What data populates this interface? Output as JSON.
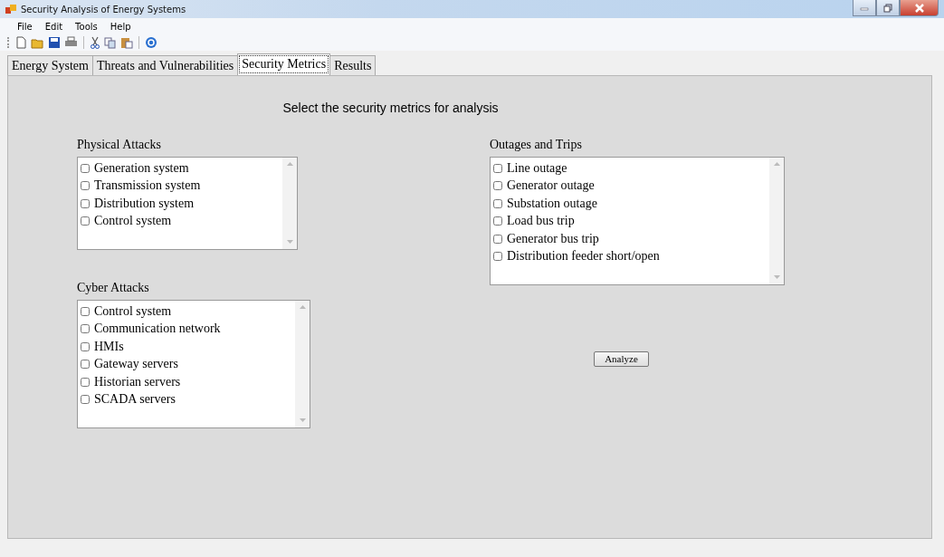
{
  "window": {
    "title": "Security Analysis of Energy Systems"
  },
  "menu": [
    {
      "label": "File"
    },
    {
      "label": "Edit"
    },
    {
      "label": "Tools"
    },
    {
      "label": "Help"
    }
  ],
  "tabs": [
    {
      "label": "Energy System",
      "selected": false
    },
    {
      "label": "Threats and Vulnerabilities",
      "selected": false
    },
    {
      "label": "Security Metrics",
      "selected": true
    },
    {
      "label": "Results",
      "selected": false
    }
  ],
  "heading": "Select the security metrics for analysis",
  "groups": [
    {
      "title": "Physical Attacks",
      "items": [
        {
          "label": "Generation system",
          "checked": false
        },
        {
          "label": "Transmission system",
          "checked": false
        },
        {
          "label": "Distribution system",
          "checked": false
        },
        {
          "label": "Control system",
          "checked": false
        }
      ]
    },
    {
      "title": "Cyber Attacks",
      "items": [
        {
          "label": "Control system",
          "checked": false
        },
        {
          "label": "Communication network",
          "checked": false
        },
        {
          "label": "HMIs",
          "checked": false
        },
        {
          "label": "Gateway servers",
          "checked": false
        },
        {
          "label": "Historian servers",
          "checked": false
        },
        {
          "label": "SCADA servers",
          "checked": false
        }
      ]
    },
    {
      "title": "Outages and Trips",
      "items": [
        {
          "label": "Line outage",
          "checked": false
        },
        {
          "label": "Generator outage",
          "checked": false
        },
        {
          "label": "Substation outage",
          "checked": false
        },
        {
          "label": "Load bus trip",
          "checked": false
        },
        {
          "label": "Generator bus trip",
          "checked": false
        },
        {
          "label": "Distribution feeder short/open",
          "checked": false
        }
      ]
    }
  ],
  "button": "Analyze"
}
